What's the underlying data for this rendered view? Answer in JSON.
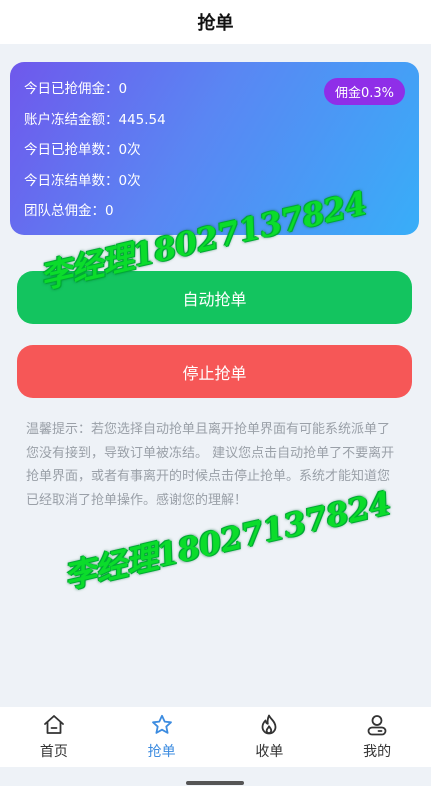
{
  "header": {
    "title": "抢单"
  },
  "stats": {
    "rows": [
      "今日已抢佣金：0",
      "账户冻结金额：445.54",
      "今日已抢单数：0次",
      "今日冻结单数：0次",
      "团队总佣金：0"
    ],
    "commission_badge": "佣金0.3%"
  },
  "actions": {
    "auto_grab_label": "自动抢单",
    "stop_grab_label": "停止抢单"
  },
  "tip": {
    "text": "温馨提示：若您选择自动抢单且离开抢单界面有可能系统派单了您没有接到，导致订单被冻结。 建议您点击自动抢单了不要离开抢单界面，或者有事离开的时候点击停止抢单。系统才能知道您已经取消了抢单操作。感谢您的理解！"
  },
  "watermark": {
    "text": "李经理18027137824"
  },
  "tabbar": {
    "items": [
      {
        "label": "首页",
        "icon": "home-icon"
      },
      {
        "label": "抢单",
        "icon": "star-icon",
        "active": true
      },
      {
        "label": "收单",
        "icon": "flame-icon"
      },
      {
        "label": "我的",
        "icon": "user-icon"
      }
    ]
  },
  "colors": {
    "accent": "#3d8ce0",
    "auto_button": "#13c45f",
    "stop_button": "#f65757",
    "badge": "#8f2ee8"
  }
}
